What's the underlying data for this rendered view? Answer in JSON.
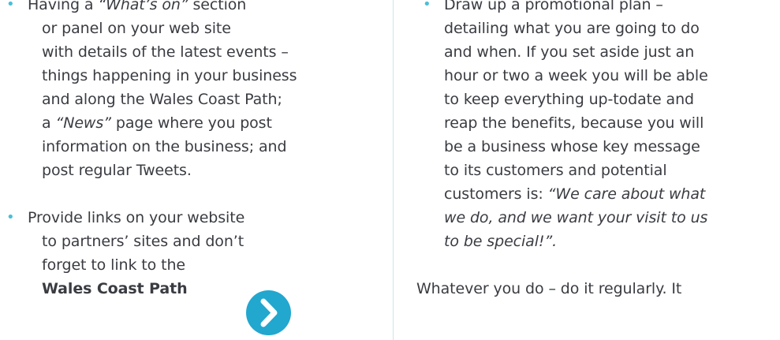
{
  "left": {
    "item1": {
      "l1_a": "Having a ",
      "l1_em": "“What’s on”",
      "l1_b": " section",
      "l2": "or panel on your web site",
      "l3": "with details of the latest events –",
      "l4": "things happening in your business",
      "l5": "and along the Wales Coast Path;",
      "l6_a": "a ",
      "l6_em": "“News”",
      "l6_b": " page where you post",
      "l7": "information on the business; and",
      "l8": "post regular Tweets."
    },
    "item2": {
      "l1": "Provide links on your website",
      "l2": "to partners’ sites and don’t",
      "l3": "forget to link to the",
      "l4_strong": "Wales Coast Path"
    },
    "arrow_icon": "chevron-right-icon"
  },
  "right": {
    "item1": {
      "l1": "Draw up a promotional plan –",
      "l2": "detailing what you are going to do",
      "l3": "and when. If you set aside just an",
      "l4": "hour or two a week you will be able",
      "l5": "to keep everything up-todate and",
      "l6": "reap the benefits, because you will",
      "l7": "be a business whose key message",
      "l8": "to its customers and potential",
      "l9_a": "customers is: ",
      "l9_em": "“We care about what",
      "l10_em": "we do, and we want your visit to us",
      "l11_em": "to be special!”."
    },
    "after": "Whatever you do – do it regularly. It"
  },
  "colors": {
    "bullet": "#4bbed8",
    "arrow_button": "#22a7cf",
    "text": "#3a3c42",
    "divider": "#cfe3ea"
  }
}
